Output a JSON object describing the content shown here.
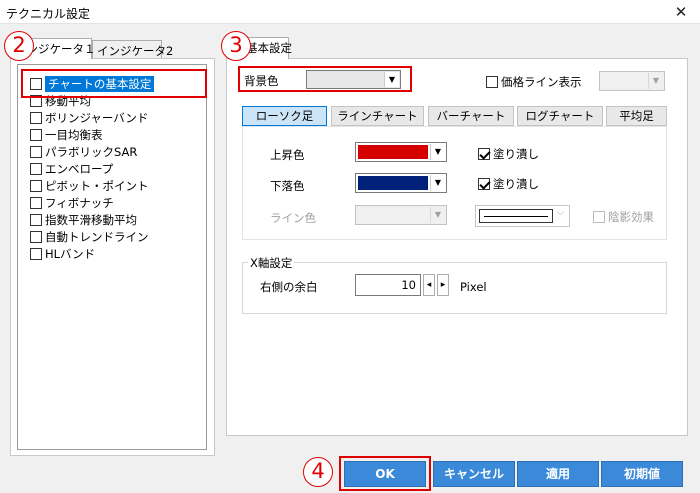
{
  "window": {
    "title": "テクニカル設定",
    "close": "✕"
  },
  "left_tabs": [
    {
      "label": "インジケータ１"
    },
    {
      "label": "インジケータ2"
    }
  ],
  "indicators": [
    {
      "label": "チャートの基本設定"
    },
    {
      "label": "移動平均"
    },
    {
      "label": "ボリンジャーバンド"
    },
    {
      "label": "一目均衡表"
    },
    {
      "label": "パラボリックSAR"
    },
    {
      "label": "エンベロープ"
    },
    {
      "label": "ピボット・ポイント"
    },
    {
      "label": "フィボナッチ"
    },
    {
      "label": "指数平滑移動平均"
    },
    {
      "label": "自動トレンドライン"
    },
    {
      "label": "HLバンド"
    }
  ],
  "right_tab": {
    "label": "基本設定"
  },
  "background": {
    "label": "背景色",
    "value": ""
  },
  "price_line": {
    "label": "価格ライン表示",
    "value": ""
  },
  "chart_tabs": [
    {
      "label": "ローソク足"
    },
    {
      "label": "ラインチャート"
    },
    {
      "label": "バーチャート"
    },
    {
      "label": "ログチャート"
    },
    {
      "label": "平均足"
    }
  ],
  "candle": {
    "up_label": "上昇色",
    "up_color": "#d40000",
    "up_fill": "塗り潰し",
    "down_label": "下落色",
    "down_color": "#00207a",
    "down_fill": "塗り潰し",
    "line_label": "ライン色",
    "shadow": "陰影効果"
  },
  "xaxis": {
    "group_label": "X軸設定",
    "margin_label": "右側の余白",
    "margin_value": "10",
    "unit": "Pixel"
  },
  "buttons": {
    "ok": "OK",
    "cancel": "キャンセル",
    "apply": "適用",
    "reset": "初期値"
  },
  "callouts": {
    "c2": "2",
    "c3": "3",
    "c4": "4"
  },
  "arrows": {
    "down": "▼",
    "left": "◂",
    "right": "▸"
  }
}
